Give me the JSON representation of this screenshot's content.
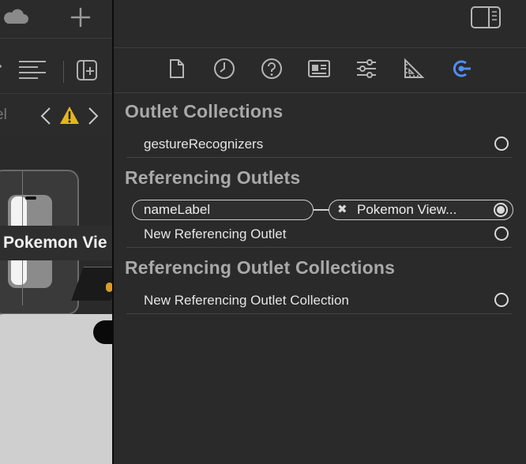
{
  "left_panel": {
    "jump_bar_partial": "el",
    "canvas_title": "Pokemon Vie"
  },
  "inspector": {
    "tabs": [
      {
        "icon": "file-icon"
      },
      {
        "icon": "history-icon"
      },
      {
        "icon": "help-icon"
      },
      {
        "icon": "identity-icon"
      },
      {
        "icon": "attributes-icon"
      },
      {
        "icon": "size-icon"
      },
      {
        "icon": "connections-icon"
      }
    ],
    "sections": {
      "outlet_collections": {
        "title": "Outlet Collections",
        "rows": [
          {
            "label": "gestureRecognizers"
          }
        ]
      },
      "referencing_outlets": {
        "title": "Referencing Outlets",
        "connection": {
          "outlet": "nameLabel",
          "target": "Pokemon View..."
        },
        "new_row": "New Referencing Outlet"
      },
      "referencing_outlet_collections": {
        "title": "Referencing Outlet Collections",
        "new_row": "New Referencing Outlet Collection"
      }
    },
    "accent_color": "#4f8ef7"
  }
}
